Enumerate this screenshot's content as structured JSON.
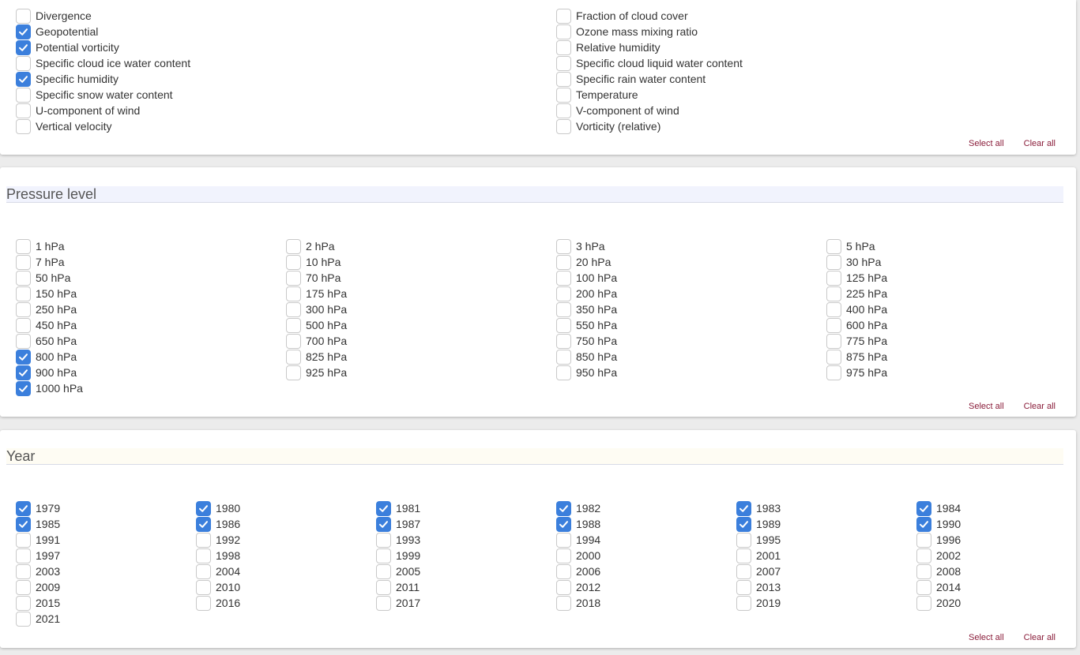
{
  "variable": {
    "options": [
      {
        "label": "Divergence",
        "checked": false
      },
      {
        "label": "Fraction of cloud cover",
        "checked": false
      },
      {
        "label": "Geopotential",
        "checked": true
      },
      {
        "label": "Ozone mass mixing ratio",
        "checked": false
      },
      {
        "label": "Potential vorticity",
        "checked": true
      },
      {
        "label": "Relative humidity",
        "checked": false
      },
      {
        "label": "Specific cloud ice water content",
        "checked": false
      },
      {
        "label": "Specific cloud liquid water content",
        "checked": false
      },
      {
        "label": "Specific humidity",
        "checked": true
      },
      {
        "label": "Specific rain water content",
        "checked": false
      },
      {
        "label": "Specific snow water content",
        "checked": false
      },
      {
        "label": "Temperature",
        "checked": false
      },
      {
        "label": "U-component of wind",
        "checked": false
      },
      {
        "label": "V-component of wind",
        "checked": false
      },
      {
        "label": "Vertical velocity",
        "checked": false
      },
      {
        "label": "Vorticity (relative)",
        "checked": false
      }
    ],
    "select_all": "Select all",
    "clear_all": "Clear all"
  },
  "pressure": {
    "title": "Pressure level",
    "options": [
      {
        "label": "1 hPa",
        "checked": false
      },
      {
        "label": "2 hPa",
        "checked": false
      },
      {
        "label": "3 hPa",
        "checked": false
      },
      {
        "label": "5 hPa",
        "checked": false
      },
      {
        "label": "7 hPa",
        "checked": false
      },
      {
        "label": "10 hPa",
        "checked": false
      },
      {
        "label": "20 hPa",
        "checked": false
      },
      {
        "label": "30 hPa",
        "checked": false
      },
      {
        "label": "50 hPa",
        "checked": false
      },
      {
        "label": "70 hPa",
        "checked": false
      },
      {
        "label": "100 hPa",
        "checked": false
      },
      {
        "label": "125 hPa",
        "checked": false
      },
      {
        "label": "150 hPa",
        "checked": false
      },
      {
        "label": "175 hPa",
        "checked": false
      },
      {
        "label": "200 hPa",
        "checked": false
      },
      {
        "label": "225 hPa",
        "checked": false
      },
      {
        "label": "250 hPa",
        "checked": false
      },
      {
        "label": "300 hPa",
        "checked": false
      },
      {
        "label": "350 hPa",
        "checked": false
      },
      {
        "label": "400 hPa",
        "checked": false
      },
      {
        "label": "450 hPa",
        "checked": false
      },
      {
        "label": "500 hPa",
        "checked": false
      },
      {
        "label": "550 hPa",
        "checked": false
      },
      {
        "label": "600 hPa",
        "checked": false
      },
      {
        "label": "650 hPa",
        "checked": false
      },
      {
        "label": "700 hPa",
        "checked": false
      },
      {
        "label": "750 hPa",
        "checked": false
      },
      {
        "label": "775 hPa",
        "checked": false
      },
      {
        "label": "800 hPa",
        "checked": true
      },
      {
        "label": "825 hPa",
        "checked": false
      },
      {
        "label": "850 hPa",
        "checked": false
      },
      {
        "label": "875 hPa",
        "checked": false
      },
      {
        "label": "900 hPa",
        "checked": true
      },
      {
        "label": "925 hPa",
        "checked": false
      },
      {
        "label": "950 hPa",
        "checked": false
      },
      {
        "label": "975 hPa",
        "checked": false
      },
      {
        "label": "1000 hPa",
        "checked": true
      }
    ],
    "select_all": "Select all",
    "clear_all": "Clear all"
  },
  "year": {
    "title": "Year",
    "options": [
      {
        "label": "1979",
        "checked": true
      },
      {
        "label": "1980",
        "checked": true
      },
      {
        "label": "1981",
        "checked": true
      },
      {
        "label": "1982",
        "checked": true
      },
      {
        "label": "1983",
        "checked": true
      },
      {
        "label": "1984",
        "checked": true
      },
      {
        "label": "1985",
        "checked": true
      },
      {
        "label": "1986",
        "checked": true
      },
      {
        "label": "1987",
        "checked": true
      },
      {
        "label": "1988",
        "checked": true
      },
      {
        "label": "1989",
        "checked": true
      },
      {
        "label": "1990",
        "checked": true
      },
      {
        "label": "1991",
        "checked": false
      },
      {
        "label": "1992",
        "checked": false
      },
      {
        "label": "1993",
        "checked": false
      },
      {
        "label": "1994",
        "checked": false
      },
      {
        "label": "1995",
        "checked": false
      },
      {
        "label": "1996",
        "checked": false
      },
      {
        "label": "1997",
        "checked": false
      },
      {
        "label": "1998",
        "checked": false
      },
      {
        "label": "1999",
        "checked": false
      },
      {
        "label": "2000",
        "checked": false
      },
      {
        "label": "2001",
        "checked": false
      },
      {
        "label": "2002",
        "checked": false
      },
      {
        "label": "2003",
        "checked": false
      },
      {
        "label": "2004",
        "checked": false
      },
      {
        "label": "2005",
        "checked": false
      },
      {
        "label": "2006",
        "checked": false
      },
      {
        "label": "2007",
        "checked": false
      },
      {
        "label": "2008",
        "checked": false
      },
      {
        "label": "2009",
        "checked": false
      },
      {
        "label": "2010",
        "checked": false
      },
      {
        "label": "2011",
        "checked": false
      },
      {
        "label": "2012",
        "checked": false
      },
      {
        "label": "2013",
        "checked": false
      },
      {
        "label": "2014",
        "checked": false
      },
      {
        "label": "2015",
        "checked": false
      },
      {
        "label": "2016",
        "checked": false
      },
      {
        "label": "2017",
        "checked": false
      },
      {
        "label": "2018",
        "checked": false
      },
      {
        "label": "2019",
        "checked": false
      },
      {
        "label": "2020",
        "checked": false
      },
      {
        "label": "2021",
        "checked": false
      }
    ],
    "select_all": "Select all",
    "clear_all": "Clear all"
  },
  "colors": {
    "checkbox_checked": "#3b7fdc",
    "link": "#8a1d3a"
  }
}
